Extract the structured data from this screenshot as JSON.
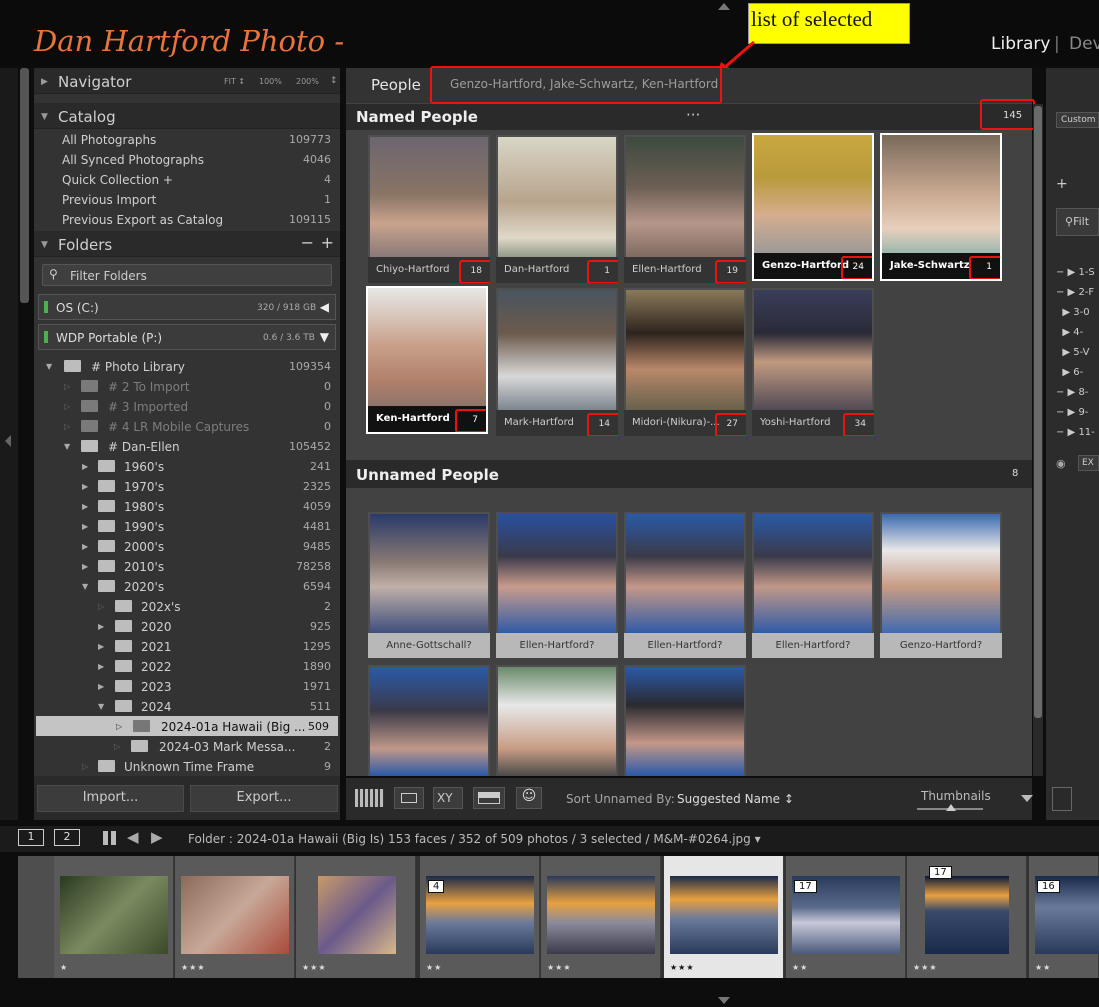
{
  "header": {
    "brand": "Dan Hartford Photo -",
    "modules": {
      "library": "Library",
      "separator": "|",
      "develop": "Dev"
    },
    "callout": "list of selected"
  },
  "navigator": {
    "title": "Navigator",
    "zoom": [
      "FIT ↕",
      "100%",
      "200%",
      "↕"
    ]
  },
  "catalog": {
    "title": "Catalog",
    "items": [
      {
        "label": "All Photographs",
        "count": "109773"
      },
      {
        "label": "All Synced Photographs",
        "count": "4046"
      },
      {
        "label": "Quick Collection +",
        "count": "4"
      },
      {
        "label": "Previous Import",
        "count": "1"
      },
      {
        "label": "Previous Export as Catalog",
        "count": "109115"
      }
    ]
  },
  "folders": {
    "title": "Folders",
    "filter_placeholder": "Filter Folders",
    "volumes": [
      {
        "name": "OS (C:)",
        "size": "320 / 918 GB"
      },
      {
        "name": "WDP Portable (P:)",
        "size": "0.6 / 3.6 TB"
      }
    ],
    "tree": [
      {
        "label": "# Photo Library",
        "count": "109354"
      },
      {
        "label": "# 2 To Import",
        "count": "0"
      },
      {
        "label": "# 3 Imported",
        "count": "0"
      },
      {
        "label": "# 4 LR Mobile Captures",
        "count": "0"
      },
      {
        "label": "# Dan-Ellen",
        "count": "105452"
      },
      {
        "label": "1960's",
        "count": "241"
      },
      {
        "label": "1970's",
        "count": "2325"
      },
      {
        "label": "1980's",
        "count": "4059"
      },
      {
        "label": "1990's",
        "count": "4481"
      },
      {
        "label": "2000's",
        "count": "9485"
      },
      {
        "label": "2010's",
        "count": "78258"
      },
      {
        "label": "2020's",
        "count": "6594"
      },
      {
        "label": "202x's",
        "count": "2"
      },
      {
        "label": "2020",
        "count": "925"
      },
      {
        "label": "2021",
        "count": "1295"
      },
      {
        "label": "2022",
        "count": "1890"
      },
      {
        "label": "2023",
        "count": "1971"
      },
      {
        "label": "2024",
        "count": "511"
      },
      {
        "label": "2024-01a Hawaii (Big ...",
        "count": "509"
      },
      {
        "label": "2024-03 Mark Messa...",
        "count": "2"
      },
      {
        "label": "Unknown Time Frame",
        "count": "9"
      }
    ]
  },
  "left_buttons": {
    "import": "Import...",
    "export": "Export..."
  },
  "people": {
    "title": "People",
    "selected_list": "Genzo-Hartford,  Jake-Schwartz,  Ken-Hartford",
    "named_title": "Named People",
    "named_dots": "···",
    "named_count": "145",
    "named": [
      {
        "name": "Chiyo-Hartford",
        "count": "18"
      },
      {
        "name": "Dan-Hartford",
        "count": "1"
      },
      {
        "name": "Ellen-Hartford",
        "count": "19"
      },
      {
        "name": "Genzo-Hartford",
        "count": "24"
      },
      {
        "name": "Jake-Schwartz",
        "count": "1"
      },
      {
        "name": "Ken-Hartford",
        "count": "7"
      },
      {
        "name": "Mark-Hartford",
        "count": "14"
      },
      {
        "name": "Midori-(Nikura)-...",
        "count": "27"
      },
      {
        "name": "Yoshi-Hartford",
        "count": "34"
      }
    ],
    "unnamed_title": "Unnamed People",
    "unnamed_count": "8",
    "unnamed": [
      "Anne-Gottschall?",
      "Ellen-Hartford?",
      "Ellen-Hartford?",
      "Ellen-Hartford?",
      "Genzo-Hartford?"
    ]
  },
  "toolbar": {
    "sort_label": "Sort Unnamed By:",
    "sort_value": "Suggested Name ↕",
    "thumbnails_label": "Thumbnails"
  },
  "filmstrip": {
    "screen1": "1",
    "screen2": "2",
    "info": "Folder : 2024-01a Hawaii (Big Is)     153 faces  / 352 of 509 photos  / 3 selected  / M&M-#0264.jpg ▾",
    "stars": [
      "★",
      "★★★",
      "★★★",
      "★★",
      "★★★",
      "★★★",
      "★★",
      "★★★",
      "★★"
    ],
    "badges": [
      "",
      "",
      "",
      "4",
      "",
      "",
      "17",
      "17",
      "16"
    ]
  },
  "right_panel": {
    "preset": "Custom",
    "filter_label": "Filt",
    "expand": "EX",
    "items": [
      "1-S",
      "2-F",
      "3-0",
      "4-",
      "5-V",
      "6-",
      "8-",
      "9-",
      "11-"
    ]
  }
}
